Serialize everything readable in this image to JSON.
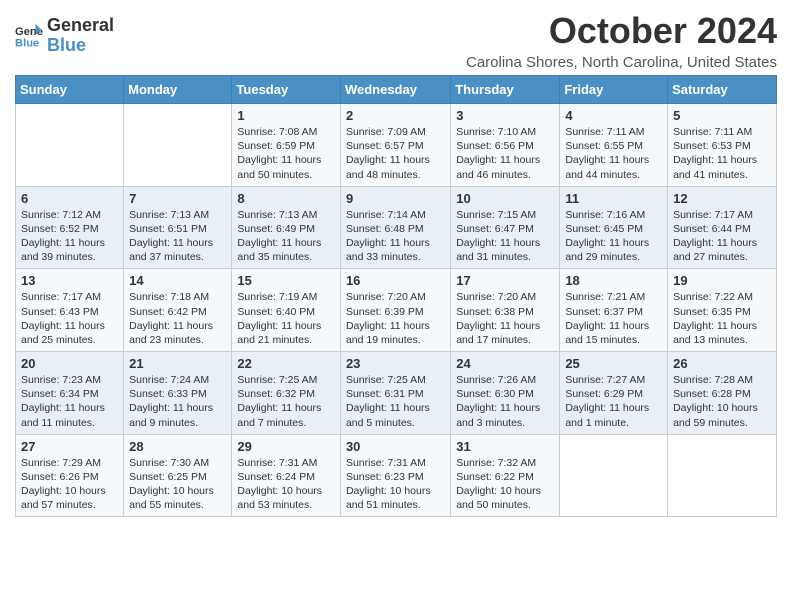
{
  "header": {
    "logo_line1": "General",
    "logo_line2": "Blue",
    "month_title": "October 2024",
    "subtitle": "Carolina Shores, North Carolina, United States"
  },
  "days_of_week": [
    "Sunday",
    "Monday",
    "Tuesday",
    "Wednesday",
    "Thursday",
    "Friday",
    "Saturday"
  ],
  "weeks": [
    [
      {
        "day": "",
        "info": ""
      },
      {
        "day": "",
        "info": ""
      },
      {
        "day": "1",
        "info": "Sunrise: 7:08 AM\nSunset: 6:59 PM\nDaylight: 11 hours and 50 minutes."
      },
      {
        "day": "2",
        "info": "Sunrise: 7:09 AM\nSunset: 6:57 PM\nDaylight: 11 hours and 48 minutes."
      },
      {
        "day": "3",
        "info": "Sunrise: 7:10 AM\nSunset: 6:56 PM\nDaylight: 11 hours and 46 minutes."
      },
      {
        "day": "4",
        "info": "Sunrise: 7:11 AM\nSunset: 6:55 PM\nDaylight: 11 hours and 44 minutes."
      },
      {
        "day": "5",
        "info": "Sunrise: 7:11 AM\nSunset: 6:53 PM\nDaylight: 11 hours and 41 minutes."
      }
    ],
    [
      {
        "day": "6",
        "info": "Sunrise: 7:12 AM\nSunset: 6:52 PM\nDaylight: 11 hours and 39 minutes."
      },
      {
        "day": "7",
        "info": "Sunrise: 7:13 AM\nSunset: 6:51 PM\nDaylight: 11 hours and 37 minutes."
      },
      {
        "day": "8",
        "info": "Sunrise: 7:13 AM\nSunset: 6:49 PM\nDaylight: 11 hours and 35 minutes."
      },
      {
        "day": "9",
        "info": "Sunrise: 7:14 AM\nSunset: 6:48 PM\nDaylight: 11 hours and 33 minutes."
      },
      {
        "day": "10",
        "info": "Sunrise: 7:15 AM\nSunset: 6:47 PM\nDaylight: 11 hours and 31 minutes."
      },
      {
        "day": "11",
        "info": "Sunrise: 7:16 AM\nSunset: 6:45 PM\nDaylight: 11 hours and 29 minutes."
      },
      {
        "day": "12",
        "info": "Sunrise: 7:17 AM\nSunset: 6:44 PM\nDaylight: 11 hours and 27 minutes."
      }
    ],
    [
      {
        "day": "13",
        "info": "Sunrise: 7:17 AM\nSunset: 6:43 PM\nDaylight: 11 hours and 25 minutes."
      },
      {
        "day": "14",
        "info": "Sunrise: 7:18 AM\nSunset: 6:42 PM\nDaylight: 11 hours and 23 minutes."
      },
      {
        "day": "15",
        "info": "Sunrise: 7:19 AM\nSunset: 6:40 PM\nDaylight: 11 hours and 21 minutes."
      },
      {
        "day": "16",
        "info": "Sunrise: 7:20 AM\nSunset: 6:39 PM\nDaylight: 11 hours and 19 minutes."
      },
      {
        "day": "17",
        "info": "Sunrise: 7:20 AM\nSunset: 6:38 PM\nDaylight: 11 hours and 17 minutes."
      },
      {
        "day": "18",
        "info": "Sunrise: 7:21 AM\nSunset: 6:37 PM\nDaylight: 11 hours and 15 minutes."
      },
      {
        "day": "19",
        "info": "Sunrise: 7:22 AM\nSunset: 6:35 PM\nDaylight: 11 hours and 13 minutes."
      }
    ],
    [
      {
        "day": "20",
        "info": "Sunrise: 7:23 AM\nSunset: 6:34 PM\nDaylight: 11 hours and 11 minutes."
      },
      {
        "day": "21",
        "info": "Sunrise: 7:24 AM\nSunset: 6:33 PM\nDaylight: 11 hours and 9 minutes."
      },
      {
        "day": "22",
        "info": "Sunrise: 7:25 AM\nSunset: 6:32 PM\nDaylight: 11 hours and 7 minutes."
      },
      {
        "day": "23",
        "info": "Sunrise: 7:25 AM\nSunset: 6:31 PM\nDaylight: 11 hours and 5 minutes."
      },
      {
        "day": "24",
        "info": "Sunrise: 7:26 AM\nSunset: 6:30 PM\nDaylight: 11 hours and 3 minutes."
      },
      {
        "day": "25",
        "info": "Sunrise: 7:27 AM\nSunset: 6:29 PM\nDaylight: 11 hours and 1 minute."
      },
      {
        "day": "26",
        "info": "Sunrise: 7:28 AM\nSunset: 6:28 PM\nDaylight: 10 hours and 59 minutes."
      }
    ],
    [
      {
        "day": "27",
        "info": "Sunrise: 7:29 AM\nSunset: 6:26 PM\nDaylight: 10 hours and 57 minutes."
      },
      {
        "day": "28",
        "info": "Sunrise: 7:30 AM\nSunset: 6:25 PM\nDaylight: 10 hours and 55 minutes."
      },
      {
        "day": "29",
        "info": "Sunrise: 7:31 AM\nSunset: 6:24 PM\nDaylight: 10 hours and 53 minutes."
      },
      {
        "day": "30",
        "info": "Sunrise: 7:31 AM\nSunset: 6:23 PM\nDaylight: 10 hours and 51 minutes."
      },
      {
        "day": "31",
        "info": "Sunrise: 7:32 AM\nSunset: 6:22 PM\nDaylight: 10 hours and 50 minutes."
      },
      {
        "day": "",
        "info": ""
      },
      {
        "day": "",
        "info": ""
      }
    ]
  ]
}
